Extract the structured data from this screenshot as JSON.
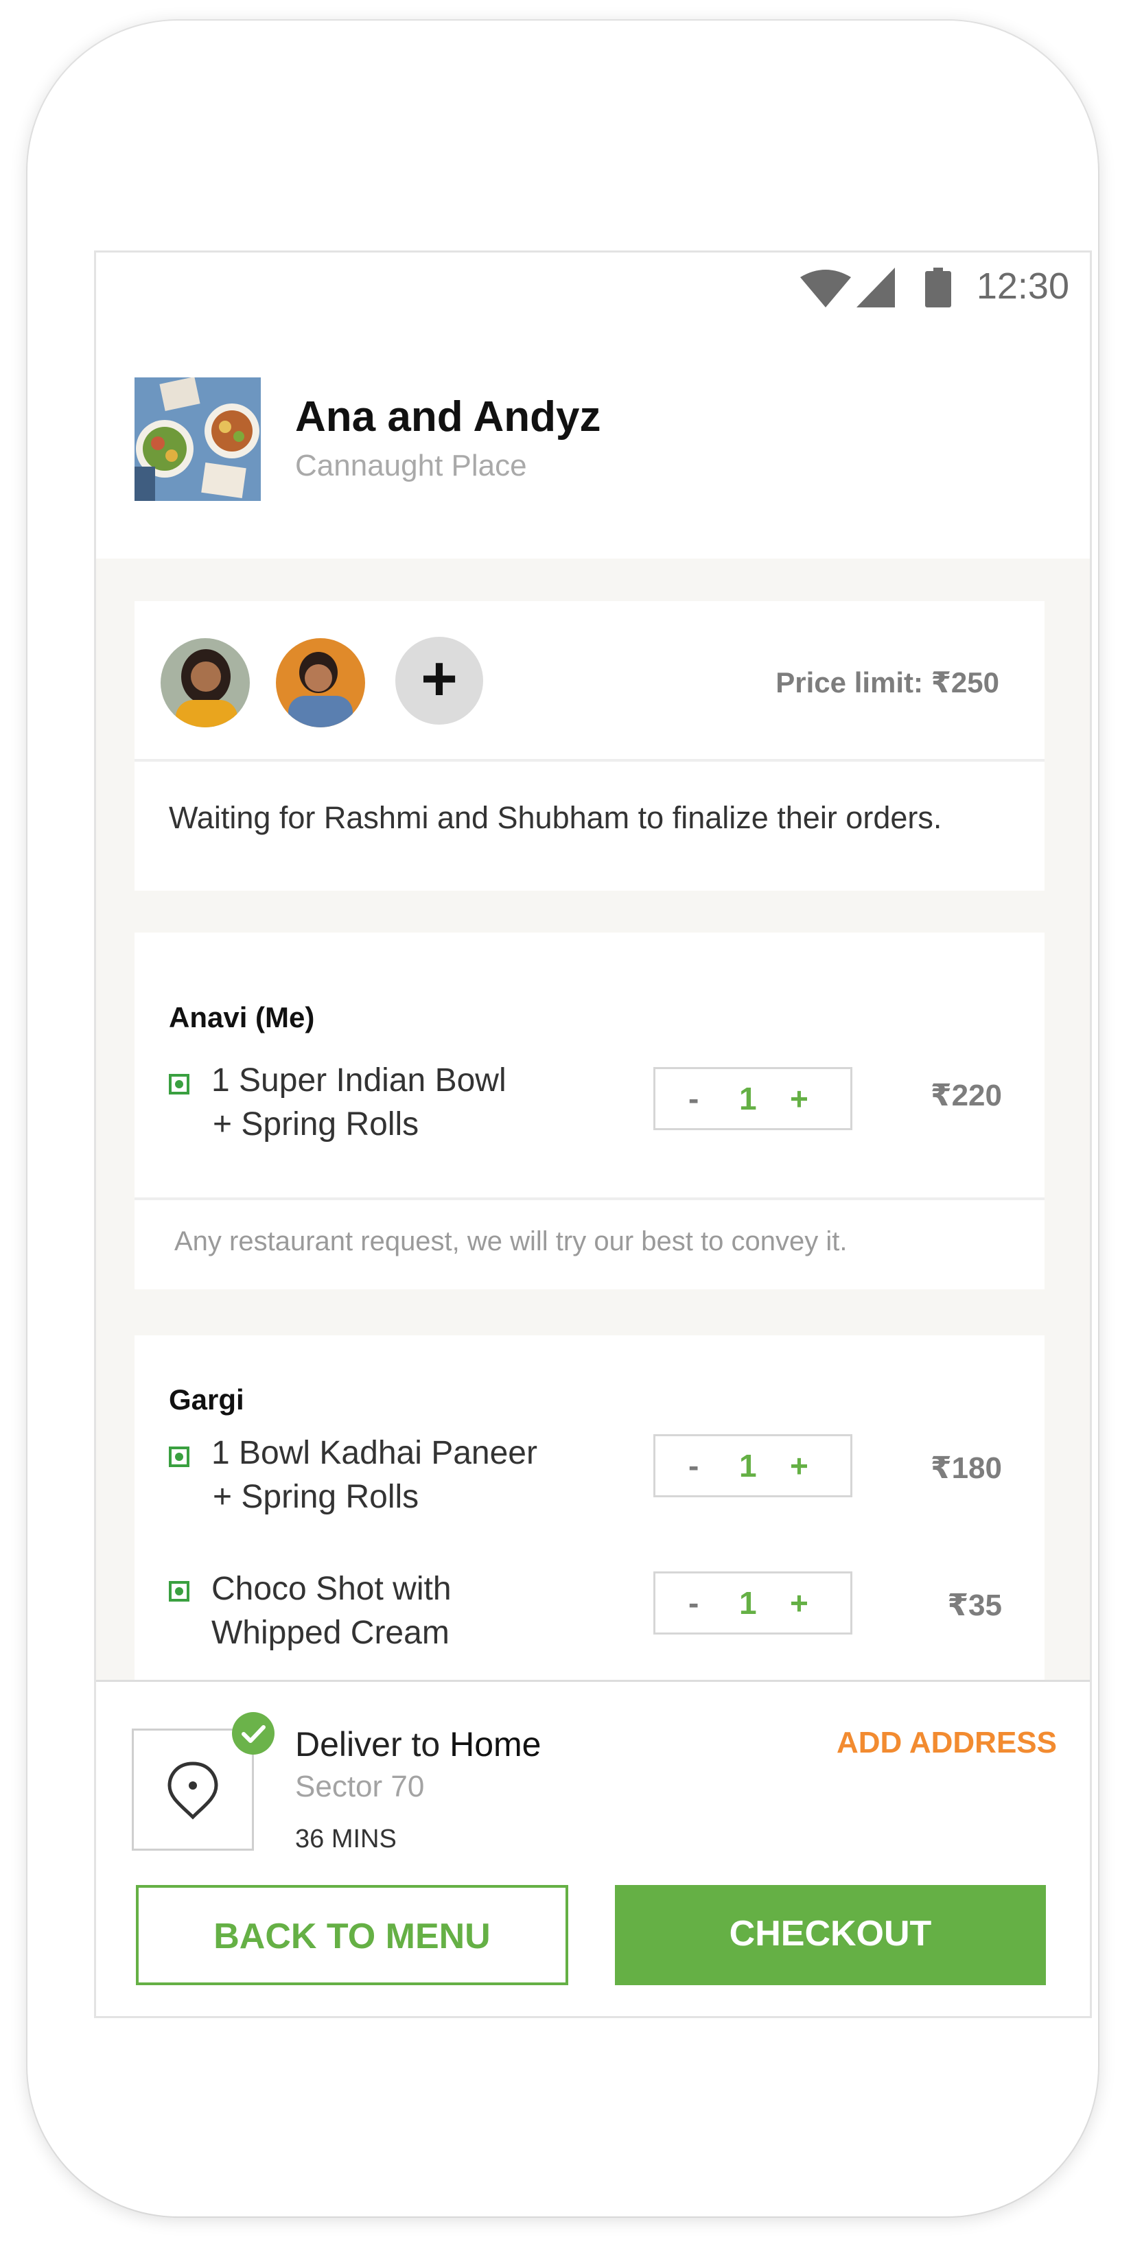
{
  "status_bar": {
    "time": "12:30",
    "icons": [
      "wifi-icon",
      "signal-icon",
      "battery-icon"
    ]
  },
  "restaurant": {
    "name": "Ana and Andyz",
    "location": "Cannaught Place"
  },
  "group": {
    "price_limit": "Price limit: ₹250",
    "add_symbol": "+",
    "waiting_message": "Waiting for Rashmi and Shubham to finalize their orders."
  },
  "orders": [
    {
      "person": "Anavi (Me)",
      "items": [
        {
          "line1": "1 Super Indian Bowl",
          "line2": "+ Spring Rolls",
          "qty": "1",
          "price": "₹220"
        }
      ],
      "request_placeholder": "Any restaurant request, we will try our best to convey it."
    },
    {
      "person": "Gargi",
      "items": [
        {
          "line1": "1 Bowl Kadhai Paneer",
          "line2": "+ Spring Rolls",
          "qty": "1",
          "price": "₹180"
        },
        {
          "line1": "Choco Shot with",
          "line2": "Whipped Cream",
          "qty": "1",
          "price": "₹35"
        }
      ]
    }
  ],
  "stepper": {
    "minus": "-",
    "plus": "+"
  },
  "delivery": {
    "label": "Deliver to",
    "place": "Home",
    "sector": "Sector 70",
    "eta": "36 MINS",
    "add_address": "ADD ADDRESS"
  },
  "actions": {
    "back": "BACK TO MENU",
    "checkout": "CHECKOUT"
  },
  "colors": {
    "accent_green": "#65b045",
    "orange": "#f28b30",
    "veg_green": "#3aa040"
  }
}
